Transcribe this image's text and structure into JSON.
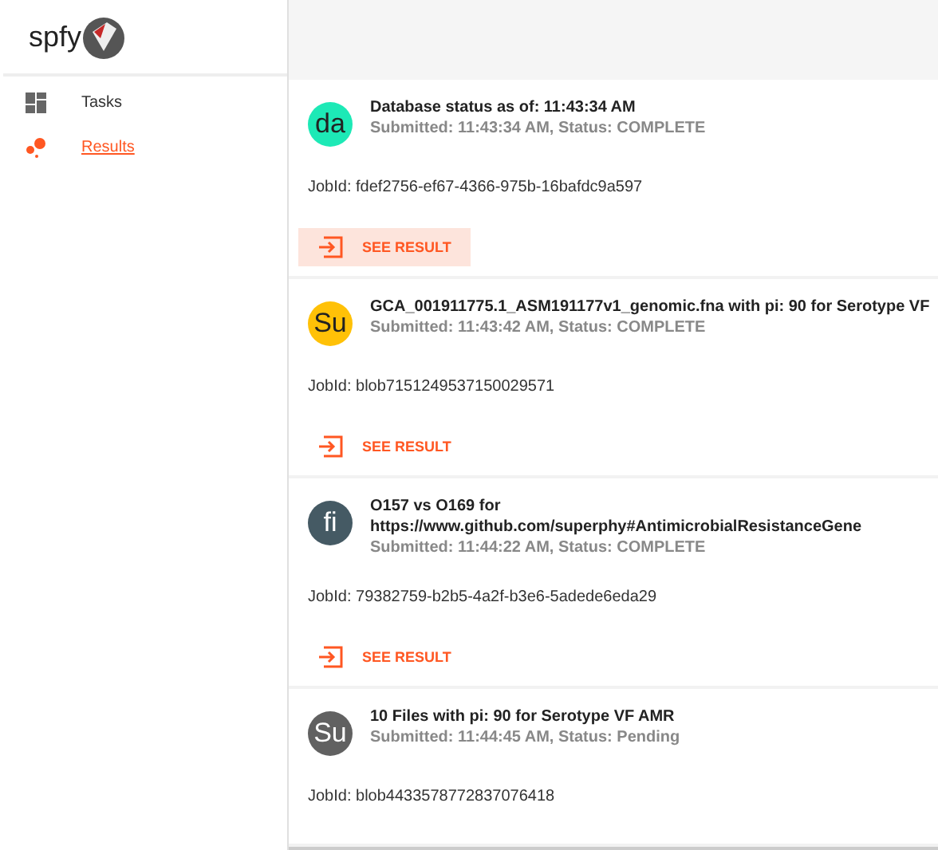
{
  "sidebar": {
    "brand": "spfy",
    "items": [
      {
        "label": "Tasks",
        "kind": "tasks",
        "selected": false
      },
      {
        "label": "Results",
        "kind": "results",
        "selected": true
      }
    ]
  },
  "results": [
    {
      "avatar": "da",
      "color": "#1de9b6",
      "title_lines": [
        "Database status as of: 11:43:34 AM"
      ],
      "subtitle": "Submitted: 11:43:34 AM, Status: COMPLETE",
      "job_id": "JobId: fdef2756-ef67-4366-975b-16bafdc9a597",
      "button": "SEE RESULT",
      "focused": true
    },
    {
      "avatar": "Su",
      "color": "#ffc107",
      "title_lines": [
        "GCA_001911775.1_ASM191177v1_genomic.fna with pi: 90 for Serotype VF"
      ],
      "subtitle": "Submitted: 11:43:42 AM, Status: COMPLETE",
      "job_id": "JobId: blob7151249537150029571",
      "button": "SEE RESULT",
      "focused": false
    },
    {
      "avatar": "fi",
      "color": "#455a64",
      "title_lines": [
        "O157 vs O169 for",
        "https://www.github.com/superphy#AntimicrobialResistanceGene"
      ],
      "subtitle": "Submitted: 11:44:22 AM, Status: COMPLETE",
      "job_id": "JobId: 79382759-b2b5-4a2f-b3e6-5adede6eda29",
      "button": "SEE RESULT",
      "focused": false
    },
    {
      "avatar": "Su",
      "color": "#616161",
      "title_lines": [
        "10 Files with pi: 90 for Serotype VF AMR"
      ],
      "subtitle": "Submitted: 11:44:45 AM, Status: Pending",
      "job_id": "JobId: blob4433578772837076418"
    }
  ]
}
